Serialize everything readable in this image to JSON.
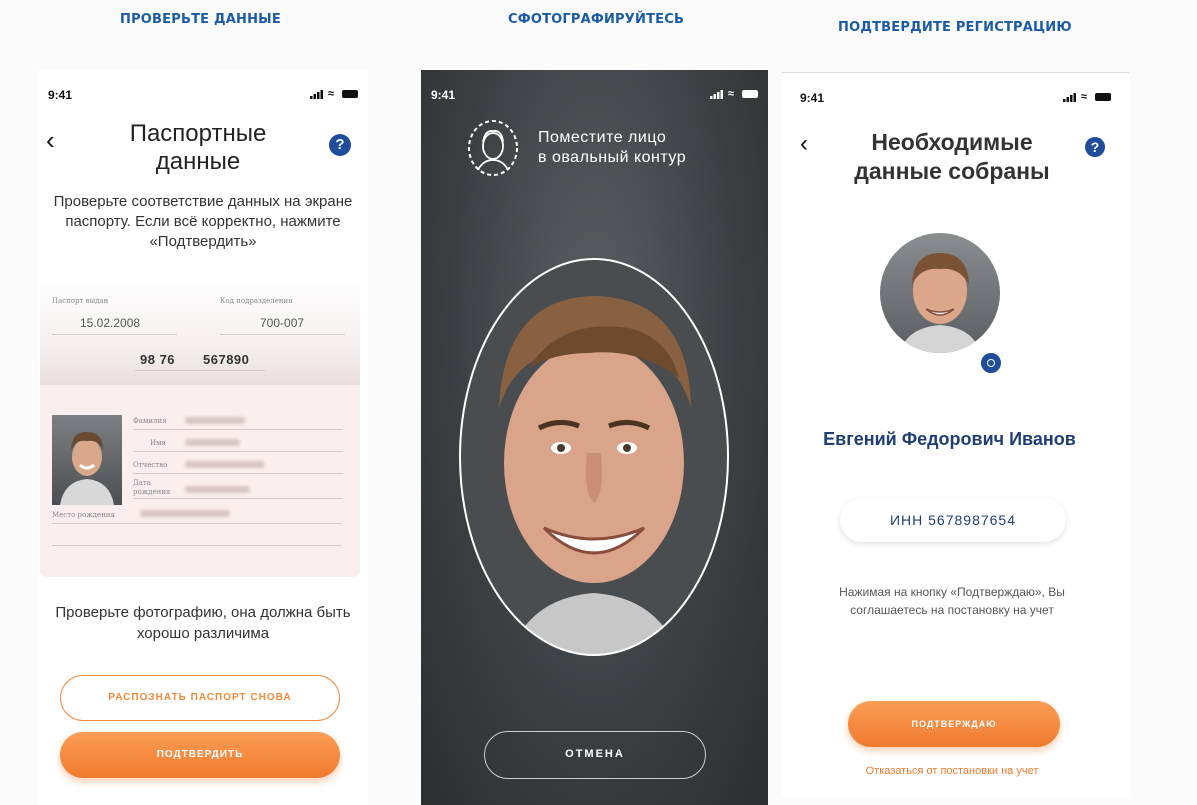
{
  "steps": {
    "check": "ПРОВЕРЬТЕ ДАННЫЕ",
    "photo": "СФОТОГРАФИРУЙТЕСЬ",
    "confirm": "ПОДТВЕРДИТЕ РЕГИСТРАЦИЮ"
  },
  "status": {
    "time": "9:41"
  },
  "screen1": {
    "back_icon": "chevron-left-icon",
    "help": "?",
    "title": "Паспортные данные",
    "description": "Проверьте соответствие данных на экране паспорту. Если всё корректно, нажмите «Подтвердить»",
    "passport": {
      "issue_date_label": "Паспорт выдан",
      "issue_date": "15.02.2008",
      "division_code_label": "Код подразделения",
      "division_code": "700-007",
      "series": "98 76",
      "number": "567890",
      "fields": [
        "Фамилия",
        "Имя",
        "Отчество",
        "Дата рождения",
        "Место рождения"
      ]
    },
    "photo_hint": "Проверьте фотографию, она должна быть хорошо различима",
    "rescan_button": "РАСПОЗНАТЬ ПАСПОРТ СНОВА",
    "confirm_button": "ПОДТВЕРДИТЬ"
  },
  "screen2": {
    "hint_line1": "Поместите лицо",
    "hint_line2": "в овальный контур",
    "cancel_button": "ОТМЕНА"
  },
  "screen3": {
    "title": "Необходимые данные собраны",
    "help": "?",
    "name": "Евгений Федорович Иванов",
    "inn": "ИНН 5678987654",
    "terms": "Нажимая на кнопку «Подтверждаю», Вы соглашаетесь на постановку на учет",
    "confirm_button": "ПОДТВЕРЖДАЮ",
    "decline_link": "Отказаться от постановки на учет"
  },
  "colors": {
    "brand_blue": "#1f4d9c",
    "accent_orange": "#f07a2e",
    "title_blue": "#1a5aa6"
  }
}
